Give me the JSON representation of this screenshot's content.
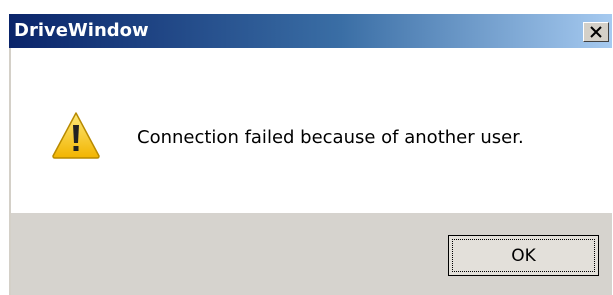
{
  "window": {
    "title": "DriveWindow"
  },
  "dialog": {
    "message": "Connection failed because of another user.",
    "icon": "warning-icon",
    "ok_label": "OK"
  },
  "colors": {
    "title_gradient_start": "#0a246a",
    "title_gradient_end": "#a6caf0",
    "footer_bg": "#d6d3ce",
    "warning_yellow": "#f6c400"
  }
}
